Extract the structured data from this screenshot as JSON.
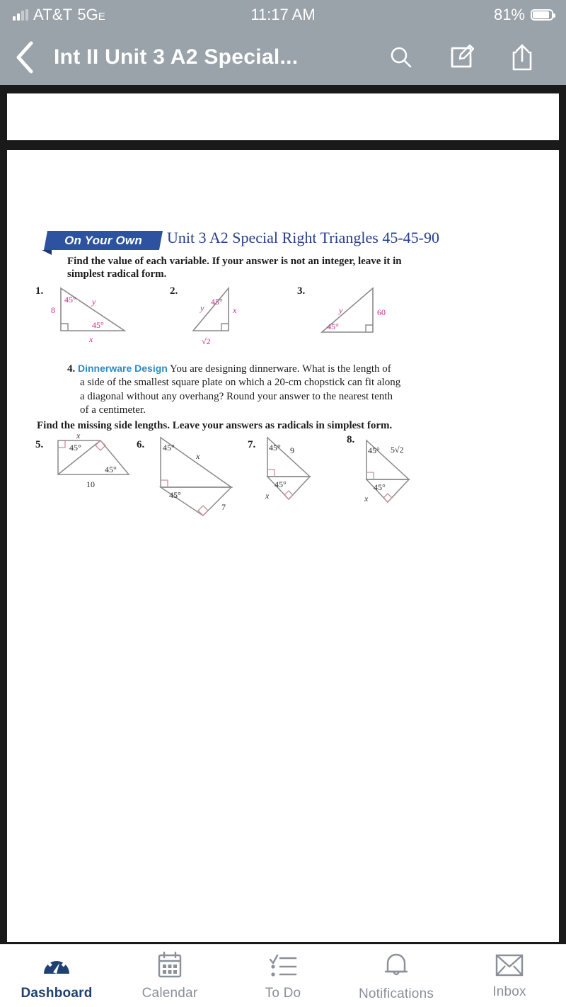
{
  "status_bar": {
    "carrier": "AT&T",
    "network": "5G",
    "network_suffix": "E",
    "time": "11:17 AM",
    "battery_percent": "81%",
    "battery_level": 81
  },
  "nav_bar": {
    "back_icon": "chevron-left-icon",
    "title": "Int II Unit 3 A2 Special...",
    "actions": [
      {
        "name": "search-icon",
        "label": "Search"
      },
      {
        "name": "annotate-icon",
        "label": "Annotate"
      },
      {
        "name": "share-icon",
        "label": "Share"
      }
    ],
    "background_color": "#9aa2aa"
  },
  "document": {
    "banner": "On Your Own",
    "banner_color": "#2c52a0",
    "title": "Unit 3 A2 Special Right Triangles 45-45-90",
    "title_color": "#27408b",
    "instruction_1": "Find the value of each variable. If your answer is not an integer, leave it in simplest radical form.",
    "instruction_2": "Find the missing side lengths.  Leave your answers as radicals in simplest form.",
    "label_color": "#c62a86",
    "line_color": "#8a8a8a",
    "right_angle_color": "#d89aa0",
    "problems": [
      {
        "number": "1.",
        "labels": {
          "leg": "8",
          "angle_top": "45°",
          "hyp": "y",
          "angle_bottom": "45°",
          "base": "x"
        }
      },
      {
        "number": "2.",
        "labels": {
          "hyp": "y",
          "angle_top": "45°",
          "leg": "x",
          "base": "√2"
        }
      },
      {
        "number": "3.",
        "labels": {
          "hyp": "y",
          "leg": "60",
          "angle": "45°"
        }
      },
      {
        "number": "4.",
        "title": "Dinnerware Design",
        "title_color": "#2d8ac4",
        "text_line_1": "You are designing dinnerware. What is the length of",
        "text_line_2": "a side of the smallest square plate on which a 20-cm chopstick can fit along",
        "text_line_3": "a diagonal without any overhang? Round your answer to the nearest tenth",
        "text_line_4": "of a centimeter."
      },
      {
        "number": "5.",
        "labels": {
          "top": "x",
          "angle_a": "45°",
          "angle_b": "45°",
          "base": "10"
        }
      },
      {
        "number": "6.",
        "labels": {
          "angle_top": "45°",
          "hyp": "x",
          "angle_low": "45°",
          "side": "7"
        }
      },
      {
        "number": "7.",
        "labels": {
          "angle_top": "45°",
          "hyp": "9",
          "angle_low": "45°",
          "side": "x"
        }
      },
      {
        "number": "8.",
        "labels": {
          "angle_top": "45°",
          "hyp": "5√2",
          "angle_low": "45°",
          "side": "x"
        }
      }
    ]
  },
  "tab_bar": {
    "active_color": "#1f4072",
    "inactive_color": "#8a9099",
    "items": [
      {
        "label": "Dashboard",
        "icon": "dashboard-gauge-icon",
        "active": true
      },
      {
        "label": "Calendar",
        "icon": "calendar-icon",
        "active": false
      },
      {
        "label": "To Do",
        "icon": "checklist-icon",
        "active": false
      },
      {
        "label": "Notifications",
        "icon": "bell-icon",
        "active": false
      },
      {
        "label": "Inbox",
        "icon": "envelope-icon",
        "active": false
      }
    ]
  }
}
